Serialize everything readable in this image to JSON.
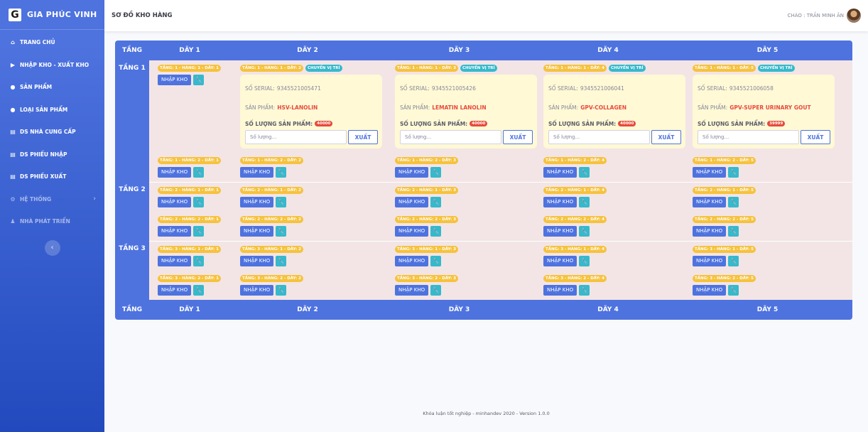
{
  "brand": {
    "logo": "G",
    "name": "GIA PHÚC VINH"
  },
  "sidebar": {
    "items": [
      {
        "label": "TRANG CHỦ",
        "icon": "home-icon",
        "glyph": "⌂"
      },
      {
        "label": "NHẬP KHO - XUẤT KHO",
        "icon": "truck-icon",
        "glyph": "▶"
      },
      {
        "label": "SẢN PHẨM",
        "icon": "circle-icon",
        "glyph": "●"
      },
      {
        "label": "LOẠI SẢN PHẨM",
        "icon": "circle-icon",
        "glyph": "●"
      },
      {
        "label": "DS NHÀ CUNG CẤP",
        "icon": "list-icon",
        "glyph": "▤"
      },
      {
        "label": "DS PHIẾU NHẬP",
        "icon": "list-icon",
        "glyph": "▤"
      },
      {
        "label": "DS PHIẾU XUẤT",
        "icon": "list-icon",
        "glyph": "▤"
      },
      {
        "label": "HỆ THỐNG",
        "icon": "gear-icon",
        "glyph": "⚙",
        "arrow": "›"
      },
      {
        "label": "NHÀ PHÁT TRIỂN",
        "icon": "users-icon",
        "glyph": "♟"
      }
    ],
    "toggle": "‹"
  },
  "topbar": {
    "title": "SƠ ĐỒ KHO HÀNG",
    "greeting": "CHÀO : TRẦN MINH ÂN"
  },
  "table": {
    "floor_header": "TẦNG",
    "columns": [
      "DÃY 1",
      "DÃY 2",
      "DÃY 3",
      "DÃY 4",
      "DÃY 5"
    ],
    "floors": [
      "TẦNG 1",
      "TẦNG 2",
      "TẦNG 3"
    ],
    "import_label": "NHẬP KHO",
    "move_label": "CHUYỂN VỊ TRÍ",
    "serial_label": "SỐ SERIAL:",
    "product_label": "SẢN PHẨM:",
    "qty_label": "SỐ LƯỢNG SẢN PHẨM:",
    "qty_placeholder": "Số lượng...",
    "export_label": "XUẤT",
    "products": [
      {
        "floor": 1,
        "row": 1,
        "col": 2,
        "serial": "9345521005471",
        "name": "HSV-LANOLIN",
        "qty": "40000"
      },
      {
        "floor": 1,
        "row": 1,
        "col": 3,
        "serial": "9345521005426",
        "name": "LEMATIN LANOLIN",
        "qty": "40000"
      },
      {
        "floor": 1,
        "row": 1,
        "col": 4,
        "serial": "9345521006041",
        "name": "GPV-COLLAGEN",
        "qty": "40000"
      },
      {
        "floor": 1,
        "row": 1,
        "col": 5,
        "serial": "9345521006058",
        "name": "GPV-SUPER URINARY GOUT",
        "qty": "39999"
      }
    ],
    "location_template": "TẦNG: {f} - HÀNG: {r} - DÃY: {c}"
  },
  "footer": {
    "text": "Khóa luận tốt nghiệp - minhandev 2020 - Version 1.0.0"
  },
  "colors": {
    "primary": "#4e73df",
    "warning": "#f6c23e",
    "info": "#36b9cc",
    "danger": "#e74a3b",
    "cellBg": "#f3e5e5",
    "productBg": "#fff9d6"
  }
}
